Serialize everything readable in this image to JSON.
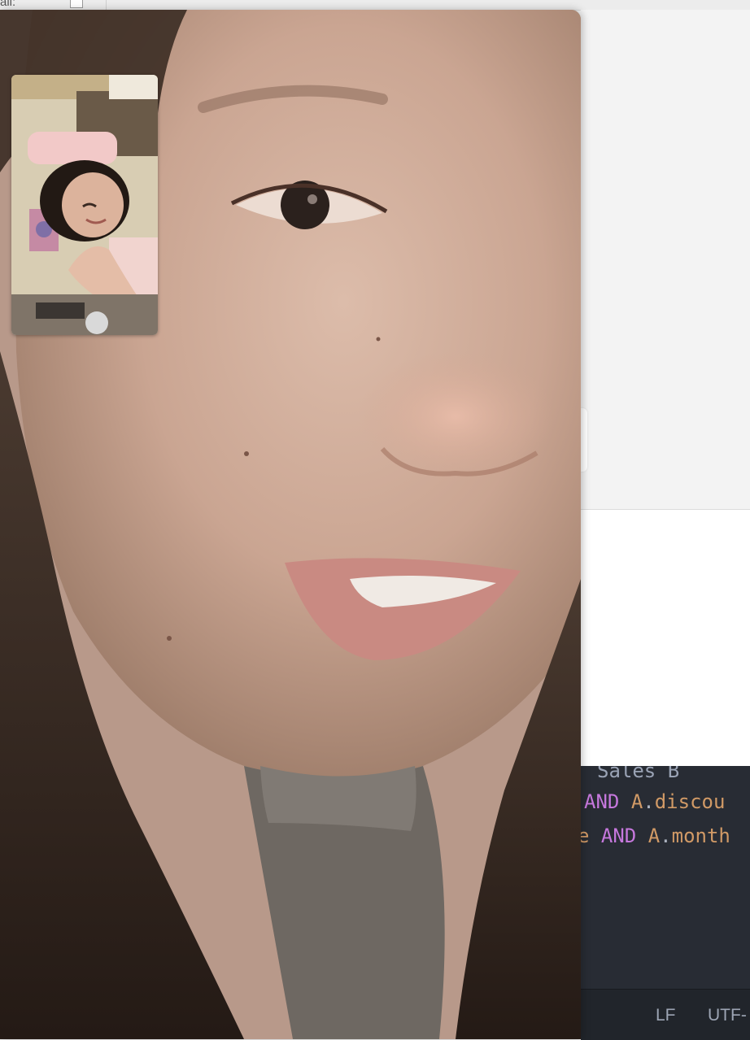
{
  "background_app": {
    "top_label": "all:",
    "editor_lines": [
      {
        "parts": [
          {
            "t": "Sales B",
            "c": "plain"
          }
        ]
      },
      {
        "parts": [
          {
            "t": "AND",
            "c": "kw"
          },
          {
            "t": " ",
            "c": "op"
          },
          {
            "t": "A",
            "c": "id"
          },
          {
            "t": ".",
            "c": "op"
          },
          {
            "t": "discou",
            "c": "id"
          }
        ]
      },
      {
        "parts": [
          {
            "t": "e",
            "c": "id"
          },
          {
            "t": " ",
            "c": "op"
          },
          {
            "t": "AND",
            "c": "kw"
          },
          {
            "t": " ",
            "c": "op"
          },
          {
            "t": "A",
            "c": "id"
          },
          {
            "t": ".",
            "c": "op"
          },
          {
            "t": "month",
            "c": "id"
          }
        ]
      }
    ],
    "status_bar": {
      "line_ending": "LF",
      "encoding": "UTF-"
    }
  },
  "call": {
    "remote_video": "remote-participant-video",
    "self_view": "self-view-video"
  },
  "colors": {
    "editor_bg": "#282c34",
    "keyword": "#c678dd",
    "identifier": "#d19a66",
    "skin": "#cfae9c",
    "hair": "#2e241e"
  }
}
